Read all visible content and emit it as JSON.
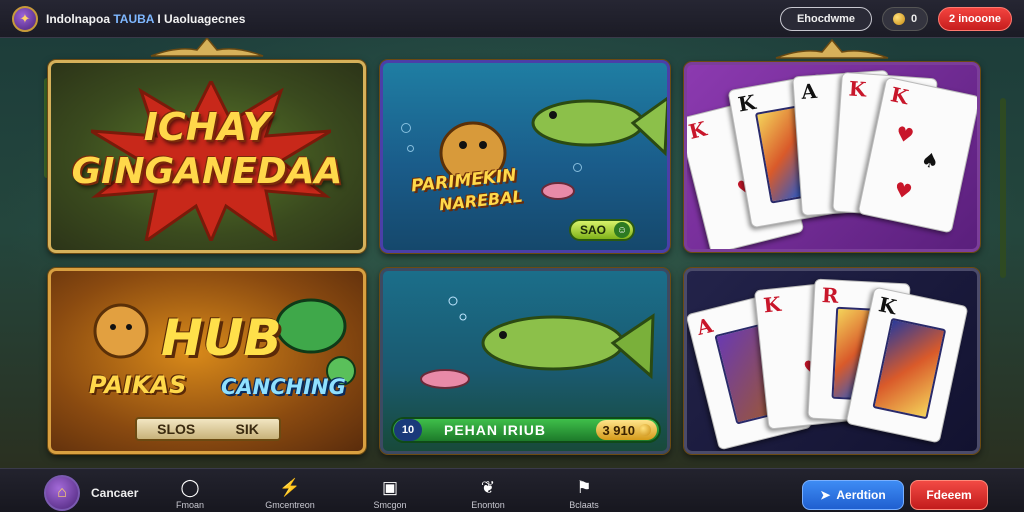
{
  "header": {
    "logo_icon": "emblem-icon",
    "title_part1": "Indolnapoa",
    "title_highlight": "TAUBA",
    "title_part2": "I Uaoluagecnes",
    "secondary_button": "Ehocdwme",
    "coins_value": "0",
    "primary_button": "2 inooone"
  },
  "tiles": [
    {
      "id": "tile-1",
      "line1": "ICHAY",
      "line2": "GINGANEDAA"
    },
    {
      "id": "tile-2",
      "line1": "PARIMEKIN",
      "line2": "NAREBAL",
      "tag": "SAO"
    },
    {
      "id": "tile-3",
      "cards": [
        "K",
        "K",
        "A",
        "K",
        "K"
      ]
    },
    {
      "id": "tile-4",
      "line1": "HUB",
      "line2": "PAIKAS",
      "line3": "CANCHING",
      "bar_left": "SLOS",
      "bar_right": "SIK"
    },
    {
      "id": "tile-5",
      "bar_label": "PEHAN IRIUB",
      "bar_icon": "10",
      "amount": "3 910"
    },
    {
      "id": "tile-6",
      "cards": [
        "A",
        "K",
        "R",
        "K"
      ]
    }
  ],
  "footer": {
    "user_name": "Cancaer",
    "nav": [
      {
        "icon": "circle-icon",
        "label": "Fmoan"
      },
      {
        "icon": "lightning-icon",
        "label": "Gmcentreon"
      },
      {
        "icon": "gift-icon",
        "label": "Smcgon"
      },
      {
        "icon": "butterfly-icon",
        "label": "Enonton"
      },
      {
        "icon": "flag-icon",
        "label": "Bclaats"
      }
    ],
    "blue_button": "Aerdtion",
    "red_button": "Fdeeem"
  },
  "colors": {
    "accent_red": "#e0302c",
    "accent_blue": "#2f74e6",
    "gold_frame": "#c9a24a"
  }
}
